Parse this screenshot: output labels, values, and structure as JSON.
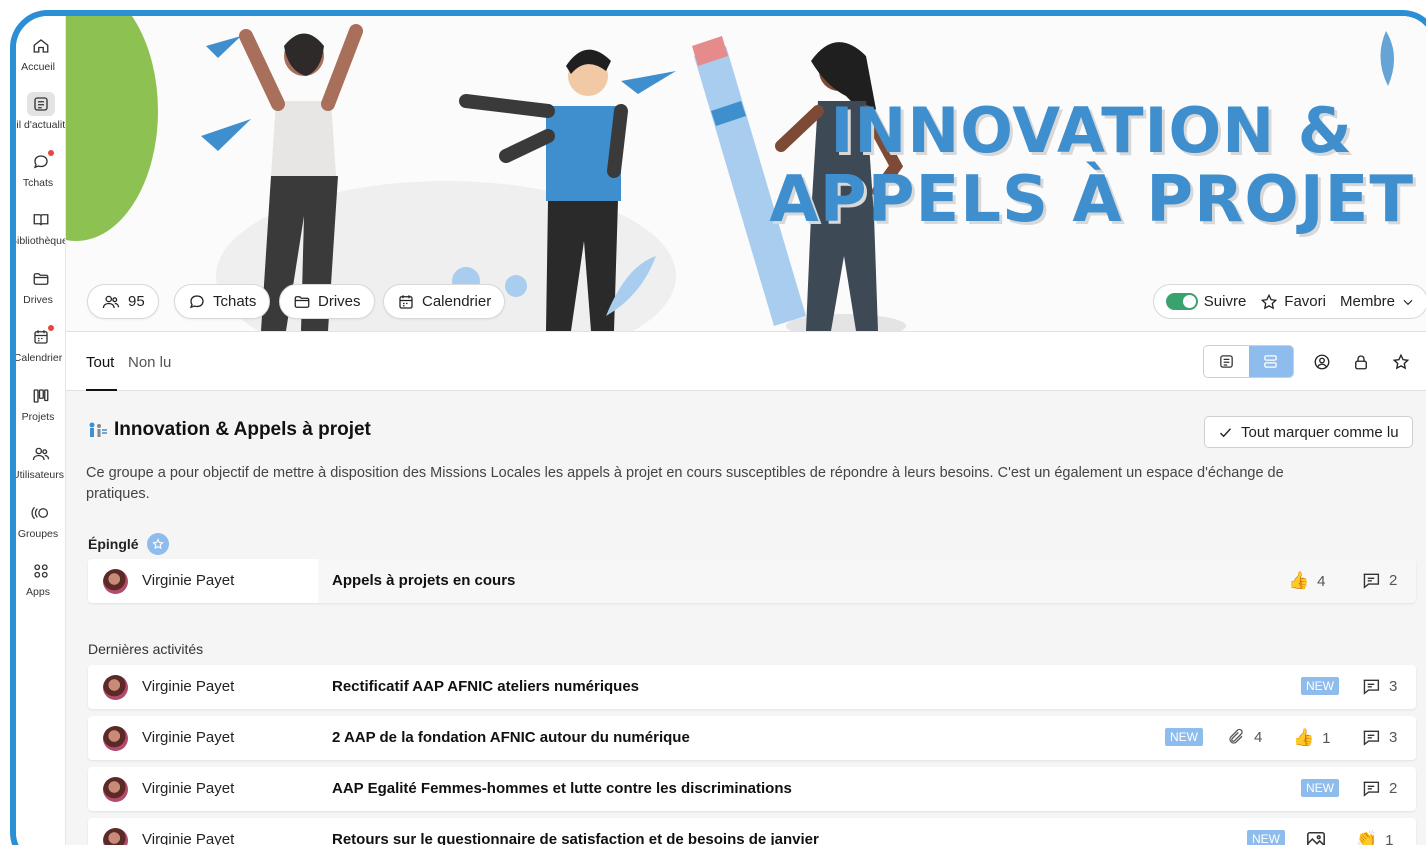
{
  "sidebar": {
    "items": [
      {
        "label": "Accueil",
        "icon": "home-icon"
      },
      {
        "label": "Fil d'actualité",
        "icon": "news-icon"
      },
      {
        "label": "Tchats",
        "icon": "chat-icon"
      },
      {
        "label": "Bibliothèque",
        "icon": "book-icon"
      },
      {
        "label": "Drives",
        "icon": "folder-icon"
      },
      {
        "label": "Calendrier",
        "icon": "calendar-icon"
      },
      {
        "label": "Projets",
        "icon": "kanban-icon"
      },
      {
        "label": "Utilisateurs",
        "icon": "users-icon"
      },
      {
        "label": "Groupes",
        "icon": "groups-icon"
      },
      {
        "label": "Apps",
        "icon": "apps-icon"
      }
    ]
  },
  "banner": {
    "title_line1": "INNOVATION &",
    "title_line2": "APPELS À PROJET",
    "members_count": "95",
    "tchats": "Tchats",
    "drives": "Drives",
    "calendrier": "Calendrier",
    "suivre": "Suivre",
    "favori": "Favori",
    "membre": "Membre"
  },
  "tabs": {
    "all": "Tout",
    "unread": "Non lu"
  },
  "group": {
    "title": "Innovation & Appels à projet",
    "mark_all_read": "Tout marquer comme lu",
    "description": "Ce groupe a pour objectif de mettre à disposition des Missions Locales les appels à projet en cours susceptibles de répondre à leurs besoins. C'est un également un espace d'échange de pratiques."
  },
  "pinned": {
    "label": "Épinglé",
    "post": {
      "author": "Virginie Payet",
      "title": "Appels à projets en cours",
      "likes": "4",
      "comments": "2"
    }
  },
  "activities": {
    "label": "Dernières activités",
    "new_badge": "NEW",
    "posts": [
      {
        "author": "Virginie Payet",
        "title": "Rectificatif AAP AFNIC ateliers numériques",
        "comments": "3"
      },
      {
        "author": "Virginie Payet",
        "title": "2 AAP de la fondation AFNIC autour du numérique",
        "attachments": "4",
        "likes": "1",
        "comments": "3"
      },
      {
        "author": "Virginie Payet",
        "title": "AAP Egalité Femmes-hommes et lutte contre les discriminations",
        "comments": "2"
      },
      {
        "author": "Virginie Payet",
        "title": "Retours sur le questionnaire de satisfaction et de besoins de janvier",
        "claps": "1"
      }
    ]
  },
  "colors": {
    "frame": "#2b8fd6",
    "accent": "#8ebcec",
    "toggle_on": "#3aa26d",
    "banner_title": "#3f8fce",
    "notification_dot": "#e5483d"
  }
}
